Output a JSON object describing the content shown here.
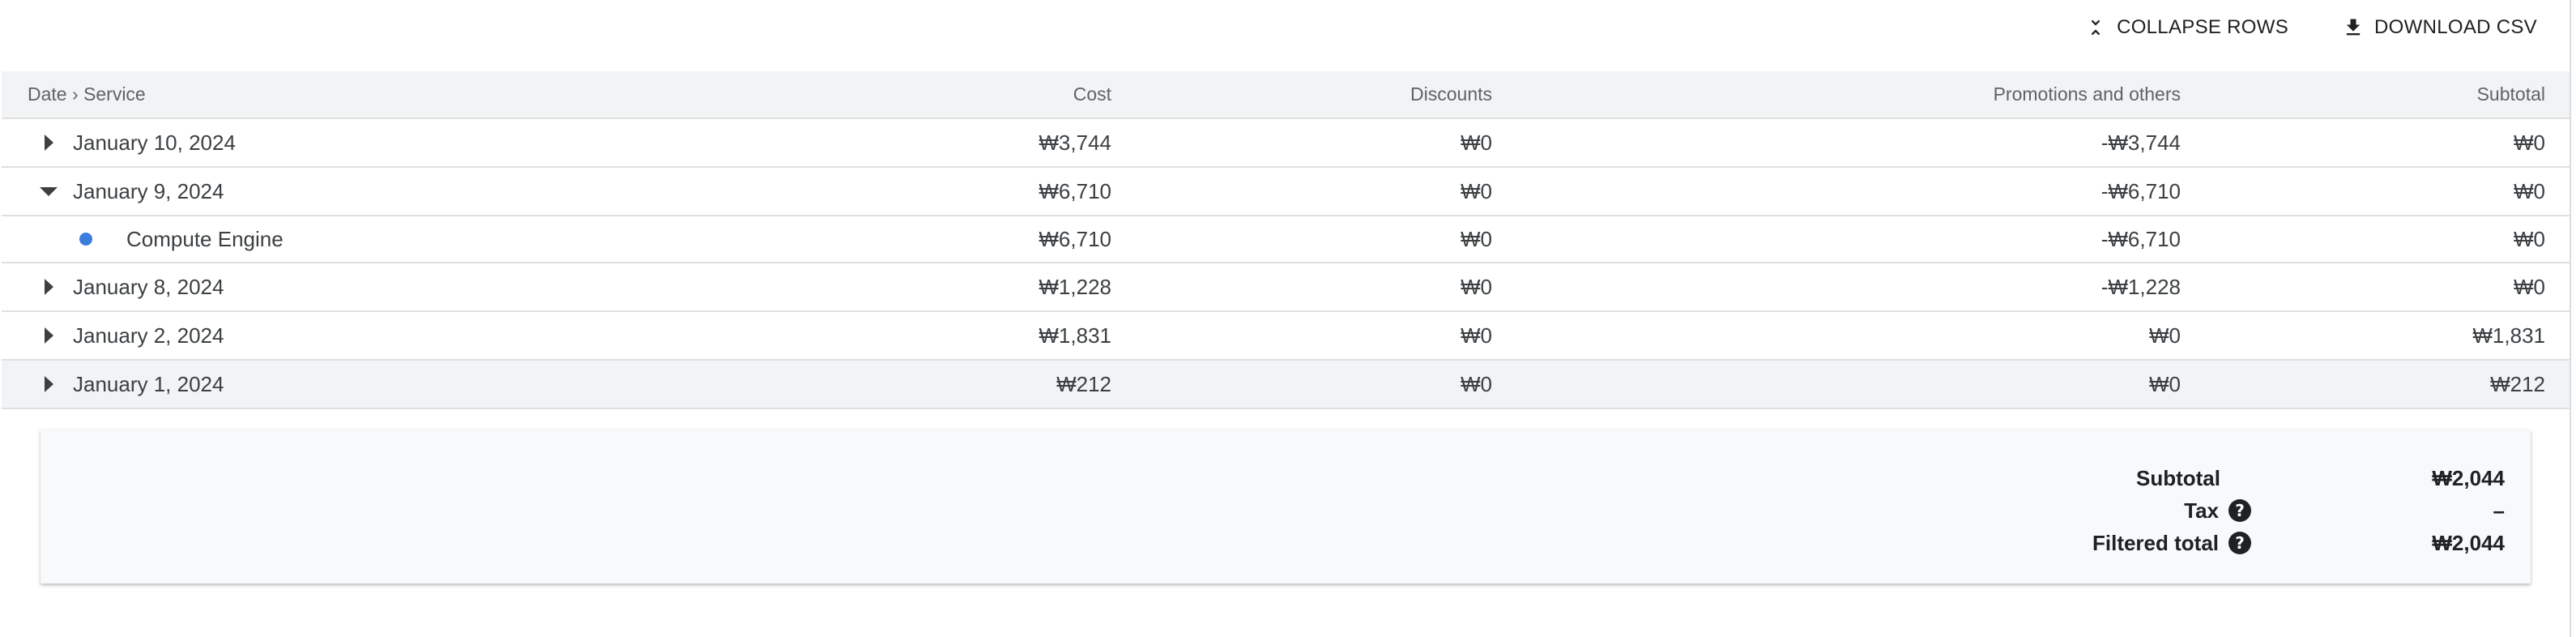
{
  "toolbar": {
    "collapse_label": "COLLAPSE ROWS",
    "download_label": "DOWNLOAD CSV"
  },
  "table": {
    "headers": [
      "Date › Service",
      "Cost",
      "Discounts",
      "Promotions and others",
      "Subtotal"
    ],
    "rows": [
      {
        "label": "January 10, 2024",
        "kind": "date",
        "expanded": false,
        "cost": "₩3,744",
        "discounts": "₩0",
        "promotions": "-₩3,744",
        "subtotal": "₩0"
      },
      {
        "label": "January 9, 2024",
        "kind": "date",
        "expanded": true,
        "cost": "₩6,710",
        "discounts": "₩0",
        "promotions": "-₩6,710",
        "subtotal": "₩0"
      },
      {
        "label": "Compute Engine",
        "kind": "service",
        "cost": "₩6,710",
        "discounts": "₩0",
        "promotions": "-₩6,710",
        "subtotal": "₩0"
      },
      {
        "label": "January 8, 2024",
        "kind": "date",
        "expanded": false,
        "cost": "₩1,228",
        "discounts": "₩0",
        "promotions": "-₩1,228",
        "subtotal": "₩0"
      },
      {
        "label": "January 2, 2024",
        "kind": "date",
        "expanded": false,
        "cost": "₩1,831",
        "discounts": "₩0",
        "promotions": "₩0",
        "subtotal": "₩1,831"
      },
      {
        "label": "January 1, 2024",
        "kind": "date",
        "expanded": false,
        "highlighted": true,
        "cost": "₩212",
        "discounts": "₩0",
        "promotions": "₩0",
        "subtotal": "₩212"
      }
    ]
  },
  "summary": {
    "subtotal_label": "Subtotal",
    "subtotal_value": "₩2,044",
    "tax_label": "Tax",
    "tax_value": "–",
    "filtered_total_label": "Filtered total",
    "filtered_total_value": "₩2,044",
    "help_glyph": "?"
  },
  "colors": {
    "service_dot": "#3b7ddd",
    "header_bg": "#f1f3f4",
    "summary_bg": "#f8f9fa"
  }
}
